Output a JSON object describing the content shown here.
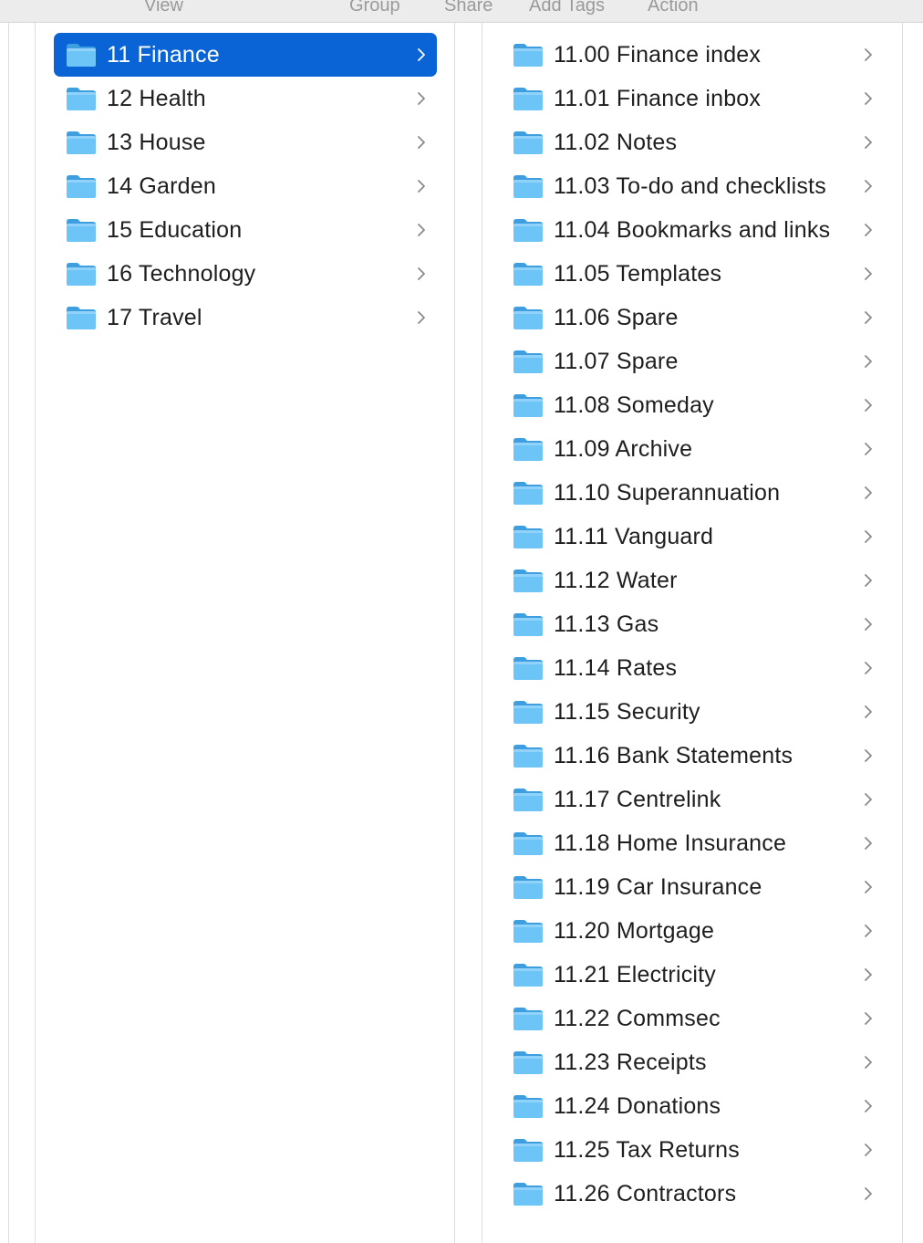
{
  "toolbar": {
    "view_label": "View",
    "group_label": "Group",
    "share_label": "Share",
    "add_tags_label": "Add Tags",
    "action_label": "Action"
  },
  "colors": {
    "selection": "#0a64d6",
    "folder_body": "#6cc4f7",
    "folder_tab": "#3d9fe0"
  },
  "left_column": {
    "items": [
      {
        "label": "11 Finance",
        "selected": true,
        "icon": "folder-icon"
      },
      {
        "label": "12 Health",
        "selected": false,
        "icon": "folder-icon"
      },
      {
        "label": "13 House",
        "selected": false,
        "icon": "folder-icon"
      },
      {
        "label": "14 Garden",
        "selected": false,
        "icon": "folder-icon"
      },
      {
        "label": "15 Education",
        "selected": false,
        "icon": "folder-icon"
      },
      {
        "label": "16 Technology",
        "selected": false,
        "icon": "folder-icon"
      },
      {
        "label": "17 Travel",
        "selected": false,
        "icon": "folder-icon"
      }
    ]
  },
  "right_column": {
    "items": [
      {
        "label": "11.00 Finance index"
      },
      {
        "label": "11.01 Finance inbox"
      },
      {
        "label": "11.02 Notes"
      },
      {
        "label": "11.03 To-do and checklists"
      },
      {
        "label": "11.04 Bookmarks and links"
      },
      {
        "label": "11.05 Templates"
      },
      {
        "label": "11.06 Spare"
      },
      {
        "label": "11.07 Spare"
      },
      {
        "label": "11.08 Someday"
      },
      {
        "label": "11.09 Archive"
      },
      {
        "label": "11.10 Superannuation"
      },
      {
        "label": "11.11 Vanguard"
      },
      {
        "label": "11.12 Water"
      },
      {
        "label": "11.13 Gas"
      },
      {
        "label": "11.14 Rates"
      },
      {
        "label": "11.15 Security"
      },
      {
        "label": "11.16 Bank Statements"
      },
      {
        "label": "11.17 Centrelink"
      },
      {
        "label": "11.18 Home Insurance"
      },
      {
        "label": "11.19 Car Insurance"
      },
      {
        "label": "11.20 Mortgage"
      },
      {
        "label": "11.21 Electricity"
      },
      {
        "label": "11.22 Commsec"
      },
      {
        "label": "11.23 Receipts"
      },
      {
        "label": "11.24 Donations"
      },
      {
        "label": "11.25 Tax Returns"
      },
      {
        "label": "11.26 Contractors"
      }
    ]
  }
}
